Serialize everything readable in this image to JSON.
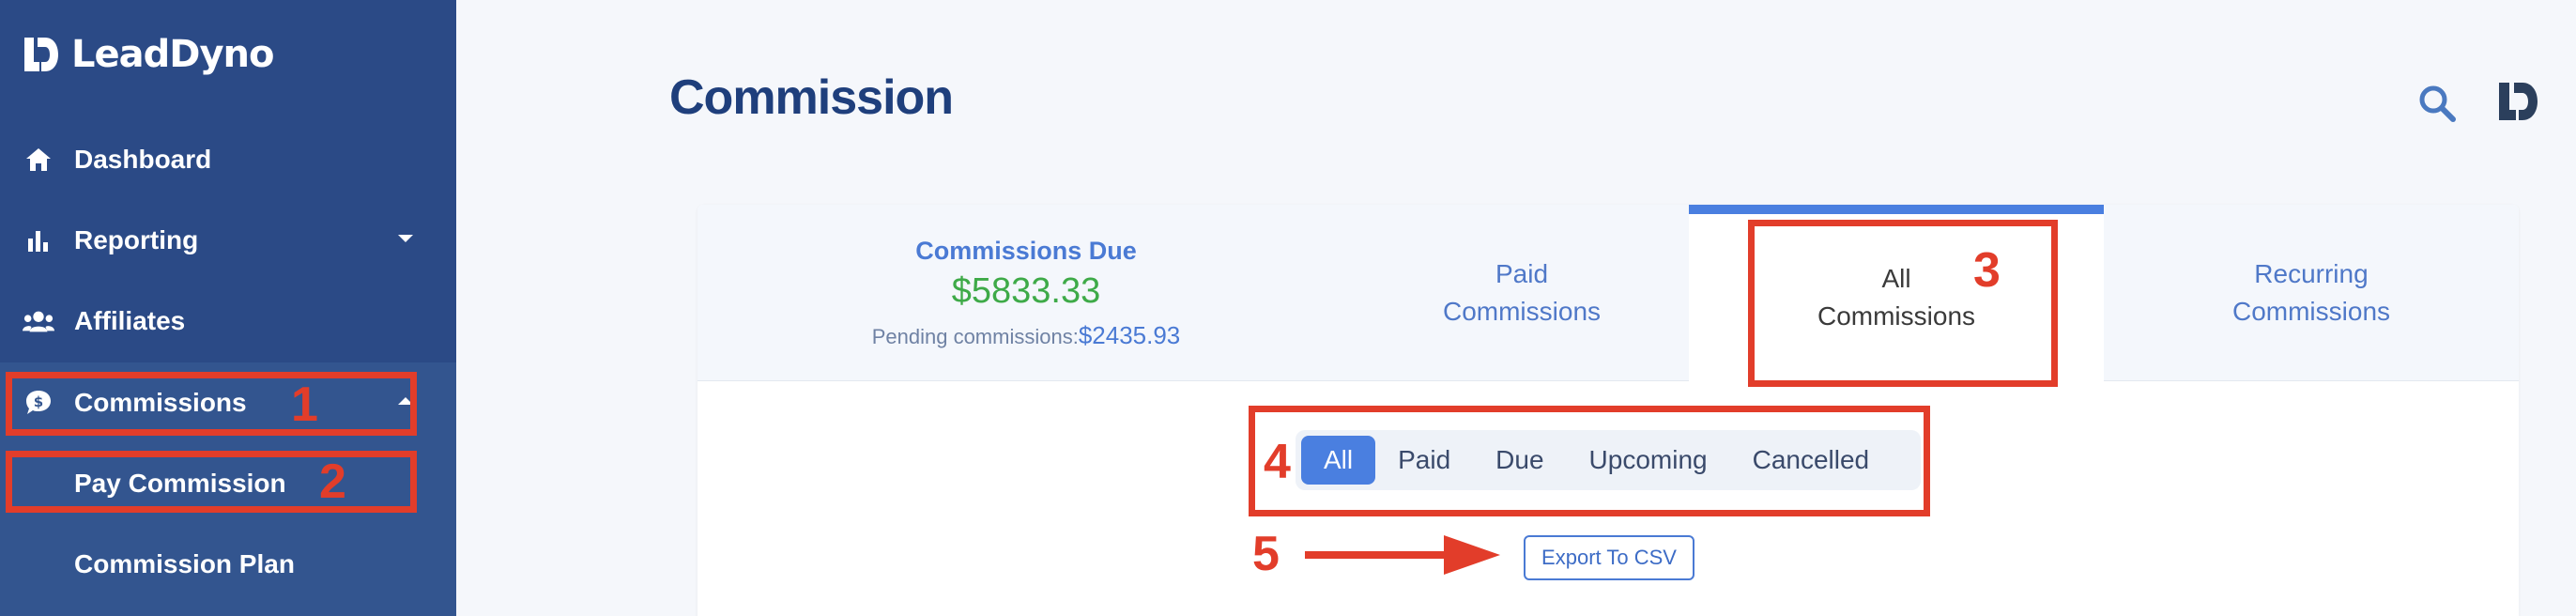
{
  "brand": {
    "name": "LeadDyno"
  },
  "sidebar": {
    "items": [
      {
        "label": "Dashboard",
        "icon": "home-icon"
      },
      {
        "label": "Reporting",
        "icon": "bar-chart-icon"
      },
      {
        "label": "Affiliates",
        "icon": "users-icon"
      },
      {
        "label": "Commissions",
        "icon": "dollar-chat-icon"
      }
    ],
    "sub_items": [
      {
        "label": "Pay Commission"
      },
      {
        "label": "Commission Plan"
      }
    ]
  },
  "header": {
    "title": "Commission"
  },
  "tabs": {
    "due_title": "Commissions Due",
    "due_amount": "$5833.33",
    "pending_label": "Pending commissions:",
    "pending_value": "$2435.93",
    "paid": {
      "line1": "Paid",
      "line2": "Commissions"
    },
    "all": {
      "line1": "All",
      "line2": "Commissions"
    },
    "recurring": {
      "line1": "Recurring",
      "line2": "Commissions"
    }
  },
  "filters": [
    "All",
    "Paid",
    "Due",
    "Upcoming",
    "Cancelled"
  ],
  "active_filter": "All",
  "export_label": "Export To CSV",
  "annotations": [
    "1",
    "2",
    "3",
    "4",
    "5"
  ],
  "colors": {
    "sidebar": "#2b4a86",
    "accent": "#4a7fe0",
    "annotation": "#e23d2a",
    "due_amount": "#3eaa48"
  }
}
